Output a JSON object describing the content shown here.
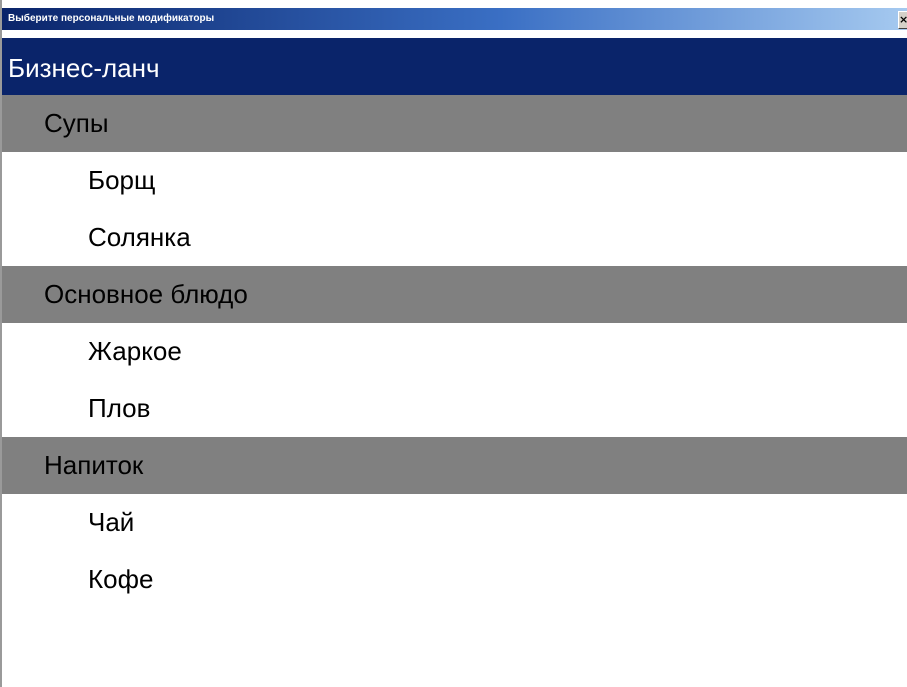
{
  "window": {
    "title": "Выберите персональные модификаторы",
    "close_label": "×"
  },
  "header": {
    "title": "Бизнес-ланч"
  },
  "groups": [
    {
      "label": "Супы",
      "items": [
        "Борщ",
        "Солянка"
      ]
    },
    {
      "label": "Основное блюдо",
      "items": [
        "Жаркое",
        "Плов"
      ]
    },
    {
      "label": "Напиток",
      "items": [
        "Чай",
        "Кофе"
      ]
    }
  ],
  "colors": {
    "header_bg": "#0a246a",
    "group_bg": "#808080",
    "item_bg": "#ffffff"
  }
}
